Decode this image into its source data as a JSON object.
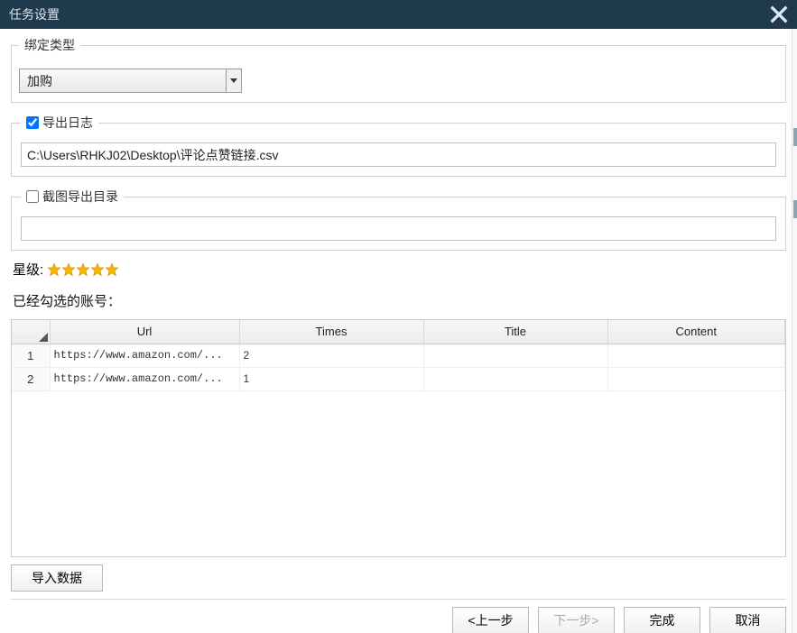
{
  "titlebar": {
    "title": "任务设置"
  },
  "bind_type": {
    "legend": "绑定类型",
    "selected": "加购"
  },
  "export_log": {
    "checked": true,
    "legend": "导出日志",
    "path": "C:\\Users\\RHKJ02\\Desktop\\评论点赞链接.csv"
  },
  "screenshot_dir": {
    "checked": false,
    "legend": "截图导出目录",
    "path": ""
  },
  "rating": {
    "label": "星级:",
    "value": 5,
    "color": "#f7b500"
  },
  "selected_accounts_label": "已经勾选的账号：",
  "table": {
    "columns": {
      "url": "Url",
      "times": "Times",
      "title": "Title",
      "content": "Content"
    },
    "rows": [
      {
        "n": "1",
        "url": "https://www.amazon.com/...",
        "times": "2",
        "title": "",
        "content": ""
      },
      {
        "n": "2",
        "url": "https://www.amazon.com/...",
        "times": "1",
        "title": "",
        "content": ""
      }
    ]
  },
  "buttons": {
    "import": "导入数据",
    "prev": "<上一步",
    "next": "下一步>",
    "finish": "完成",
    "cancel": "取消"
  }
}
